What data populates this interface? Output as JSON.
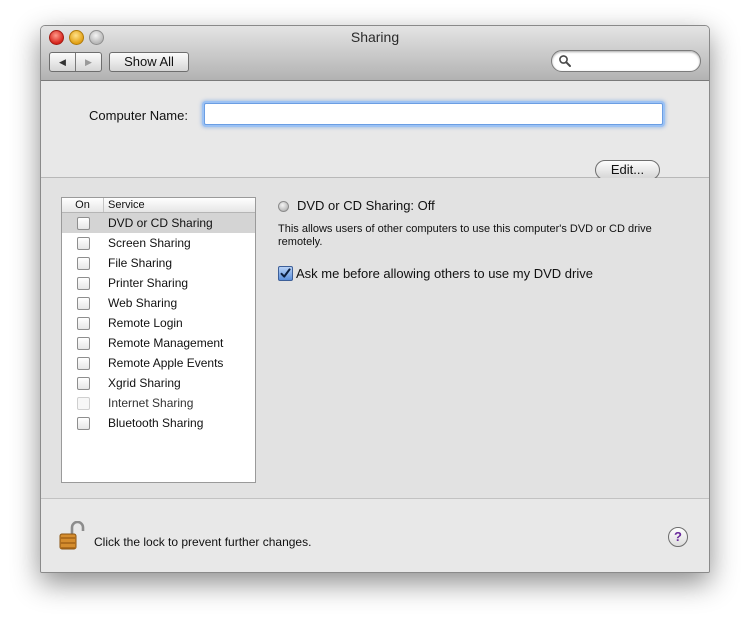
{
  "window": {
    "title": "Sharing"
  },
  "toolbar": {
    "back_icon": "◀",
    "forward_icon": "▶",
    "show_all_label": "Show All",
    "search_value": ""
  },
  "computer_name": {
    "label": "Computer Name:",
    "value": "",
    "edit_label": "Edit..."
  },
  "services": {
    "header_on": "On",
    "header_service": "Service",
    "items": [
      {
        "label": "DVD or CD Sharing",
        "checked": false,
        "selected": true,
        "enabled": true
      },
      {
        "label": "Screen Sharing",
        "checked": false,
        "selected": false,
        "enabled": true
      },
      {
        "label": "File Sharing",
        "checked": false,
        "selected": false,
        "enabled": true
      },
      {
        "label": "Printer Sharing",
        "checked": false,
        "selected": false,
        "enabled": true
      },
      {
        "label": "Web Sharing",
        "checked": false,
        "selected": false,
        "enabled": true
      },
      {
        "label": "Remote Login",
        "checked": false,
        "selected": false,
        "enabled": true
      },
      {
        "label": "Remote Management",
        "checked": false,
        "selected": false,
        "enabled": true
      },
      {
        "label": "Remote Apple Events",
        "checked": false,
        "selected": false,
        "enabled": true
      },
      {
        "label": "Xgrid Sharing",
        "checked": false,
        "selected": false,
        "enabled": true
      },
      {
        "label": "Internet Sharing",
        "checked": false,
        "selected": false,
        "enabled": false
      },
      {
        "label": "Bluetooth Sharing",
        "checked": false,
        "selected": false,
        "enabled": true
      }
    ]
  },
  "detail": {
    "status_text": "DVD or CD Sharing: Off",
    "description": "This allows users of other computers to use this computer's DVD or CD drive remotely.",
    "ask_label": "Ask me before allowing others to use my DVD drive",
    "ask_checked": true
  },
  "bottom": {
    "lock_text": "Click the lock to prevent further changes.",
    "help_label": "?"
  },
  "colors": {
    "help_question_mark": "#6a2a9c",
    "selection_row": "#d4d4d4",
    "focus_ring": "#9cc2f4"
  }
}
